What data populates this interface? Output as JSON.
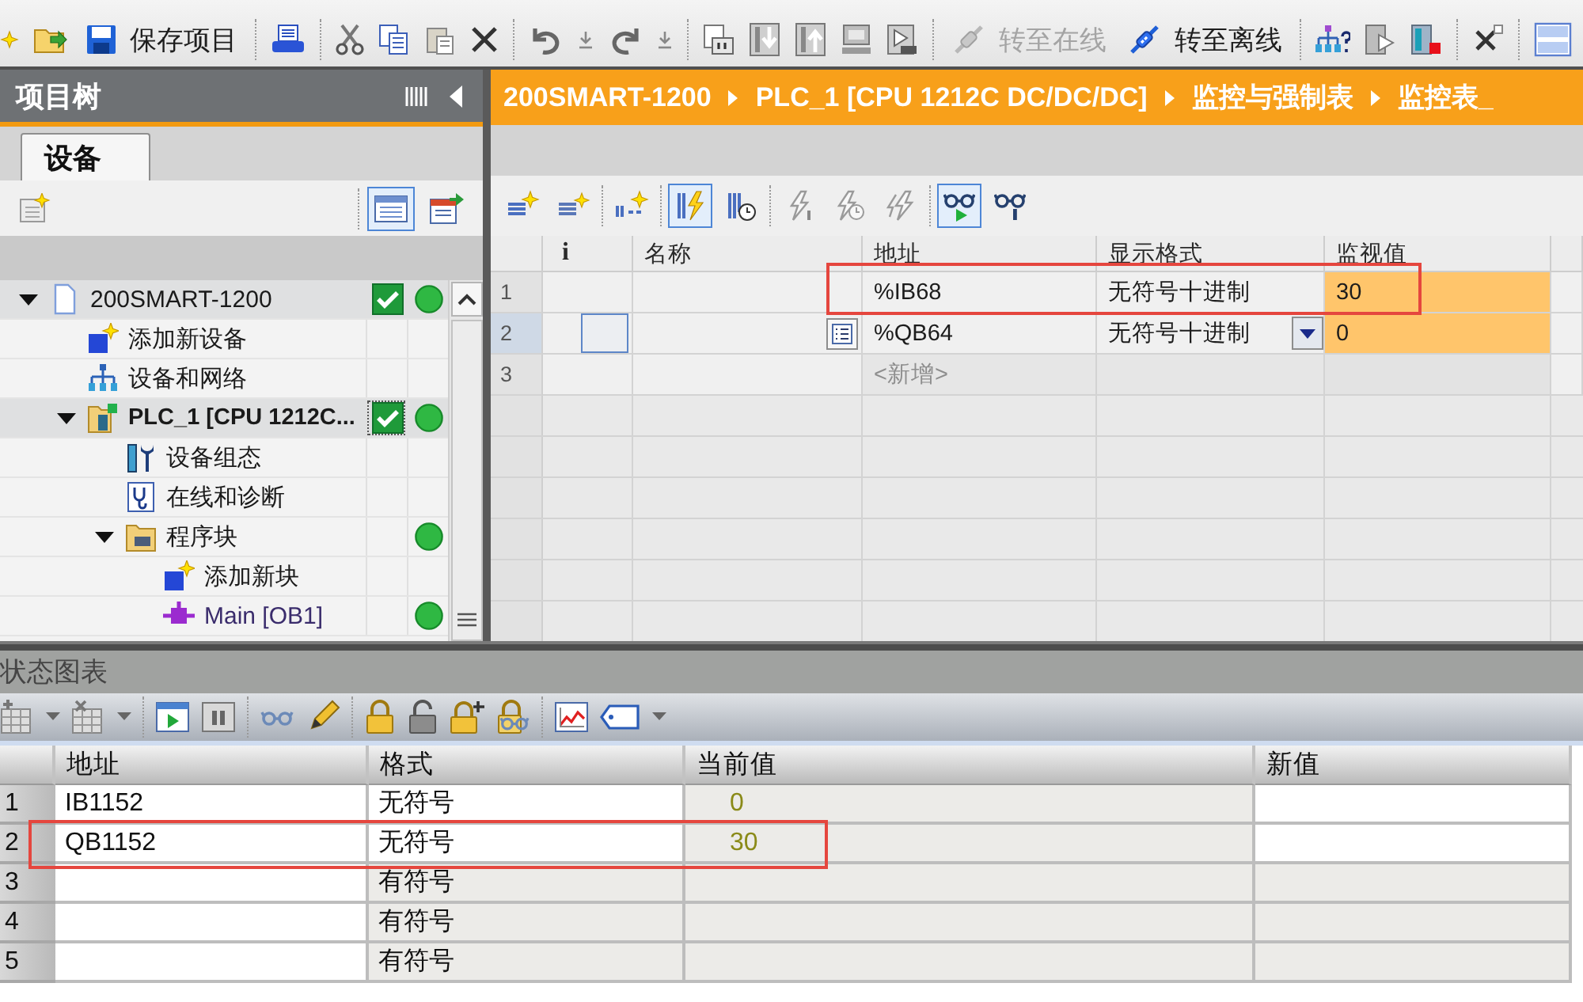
{
  "toolbar": {
    "buttons": [
      {
        "label": "保存项目",
        "disabled": false
      },
      {
        "label": "转至在线",
        "disabled": true
      },
      {
        "label": "转至离线",
        "disabled": false
      }
    ]
  },
  "project_tree": {
    "title": "项目树",
    "tabs": [
      {
        "label": "设备",
        "selected": true
      }
    ],
    "view_buttons": [
      {
        "pressed": true
      },
      {
        "pressed": false
      }
    ],
    "items": [
      {
        "kind": "project",
        "label": "200SMART-1200",
        "expanded": true,
        "selected": false,
        "in_sync": true,
        "online": true,
        "children": [
          {
            "kind": "add-device",
            "label": "添加新设备",
            "selected": false,
            "in_sync": false,
            "online": false
          },
          {
            "kind": "network",
            "label": "设备和网络",
            "selected": false,
            "in_sync": false,
            "online": false
          },
          {
            "kind": "plc",
            "label": "PLC_1 [CPU 1212C...",
            "expanded": true,
            "selected": true,
            "in_sync": true,
            "online": true,
            "children": [
              {
                "kind": "config",
                "label": "设备组态",
                "selected": false,
                "in_sync": false,
                "online": false
              },
              {
                "kind": "diagnostics",
                "label": "在线和诊断",
                "selected": false,
                "in_sync": false,
                "online": false
              },
              {
                "kind": "folder",
                "label": "程序块",
                "expanded": true,
                "selected": false,
                "in_sync": false,
                "online": true,
                "children": [
                  {
                    "kind": "add-block",
                    "label": "添加新块",
                    "selected": false,
                    "in_sync": false,
                    "online": false
                  },
                  {
                    "kind": "block",
                    "label": "Main [OB1]",
                    "selected": false,
                    "in_sync": false,
                    "online": true
                  }
                ]
              }
            ]
          }
        ]
      }
    ]
  },
  "editor": {
    "breadcrumb": [
      "200SMART-1200",
      "PLC_1 [CPU 1212C DC/DC/DC]",
      "监控与强制表",
      "监控表_"
    ],
    "tools": [
      {
        "pressed": false,
        "disabled": false
      },
      {
        "pressed": false,
        "disabled": false
      },
      {
        "pressed": false,
        "disabled": false
      },
      {
        "pressed": true,
        "disabled": false
      },
      {
        "pressed": false,
        "disabled": false
      },
      {
        "pressed": false,
        "disabled": true
      },
      {
        "pressed": false,
        "disabled": true
      },
      {
        "pressed": false,
        "disabled": true
      },
      {
        "pressed": true,
        "disabled": false
      },
      {
        "pressed": false,
        "disabled": false
      }
    ],
    "table": {
      "columns": [
        "i",
        "名称",
        "地址",
        "显示格式",
        "监视值"
      ],
      "rows": [
        {
          "number": "1",
          "address": "%IB68",
          "format": "无符号十进制",
          "monitor": "30",
          "selected": false,
          "highlighted": true
        },
        {
          "number": "2",
          "address": "%QB64",
          "format": "无符号十进制",
          "monitor": "0",
          "selected": true,
          "highlighted": false
        },
        {
          "number": "3",
          "placeholder": "<新增>",
          "selected": false,
          "highlighted": false
        }
      ]
    }
  },
  "status_chart": {
    "title": "状态图表",
    "table": {
      "columns": [
        "地址",
        "格式",
        "当前值",
        "新值"
      ],
      "rows": [
        {
          "number": "1",
          "address": "IB1152",
          "format": "无符号",
          "current": "0",
          "highlighted": false
        },
        {
          "number": "2",
          "address": "QB1152",
          "format": "无符号",
          "current": "30",
          "highlighted": true
        },
        {
          "number": "3",
          "format": "有符号",
          "highlighted": false
        },
        {
          "number": "4",
          "format": "有符号",
          "highlighted": false
        },
        {
          "number": "5",
          "format": "有符号",
          "highlighted": false
        }
      ]
    }
  }
}
